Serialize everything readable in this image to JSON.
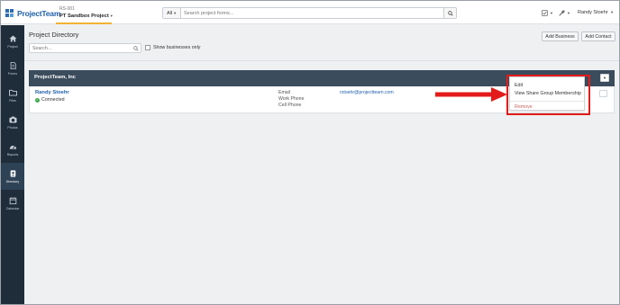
{
  "app": {
    "logo_text": "ProjectTeam"
  },
  "project": {
    "number": "RS-001",
    "name": "PT Sandbox Project"
  },
  "search": {
    "scope": "All",
    "placeholder": "Search project forms..."
  },
  "header": {
    "user_name": "Randy Stoehr"
  },
  "sidebar": {
    "items": [
      {
        "label": "Project",
        "icon": "home-icon"
      },
      {
        "label": "Forms",
        "icon": "document-icon"
      },
      {
        "label": "Files",
        "icon": "folder-icon"
      },
      {
        "label": "Photos",
        "icon": "camera-icon"
      },
      {
        "label": "Reports",
        "icon": "dashboard-icon"
      },
      {
        "label": "Directory",
        "icon": "contact-card-icon"
      },
      {
        "label": "Calendar",
        "icon": "calendar-icon"
      }
    ]
  },
  "page": {
    "title": "Project Directory",
    "search_placeholder": "Search...",
    "show_businesses_only": "Show businesses only",
    "add_business": "Add Business",
    "add_contact": "Add Contact"
  },
  "business": {
    "name": "ProjectTeam, Inc",
    "contact": {
      "name": "Randy Stoehr",
      "status": "Connected",
      "email_label": "Email",
      "email": "rstoehr@projectteam.com",
      "work_phone_label": "Work Phone",
      "cell_phone_label": "Cell Phone"
    }
  },
  "context_menu": {
    "items": [
      "Edit",
      "View Share Group Membership"
    ],
    "remove": "Remove"
  },
  "colors": {
    "sidebar": "#1f2d3b",
    "business_header": "#3b4c5c",
    "link": "#1f5fa8",
    "highlight": "#e31b1b",
    "tab_underline": "#f2b233"
  }
}
